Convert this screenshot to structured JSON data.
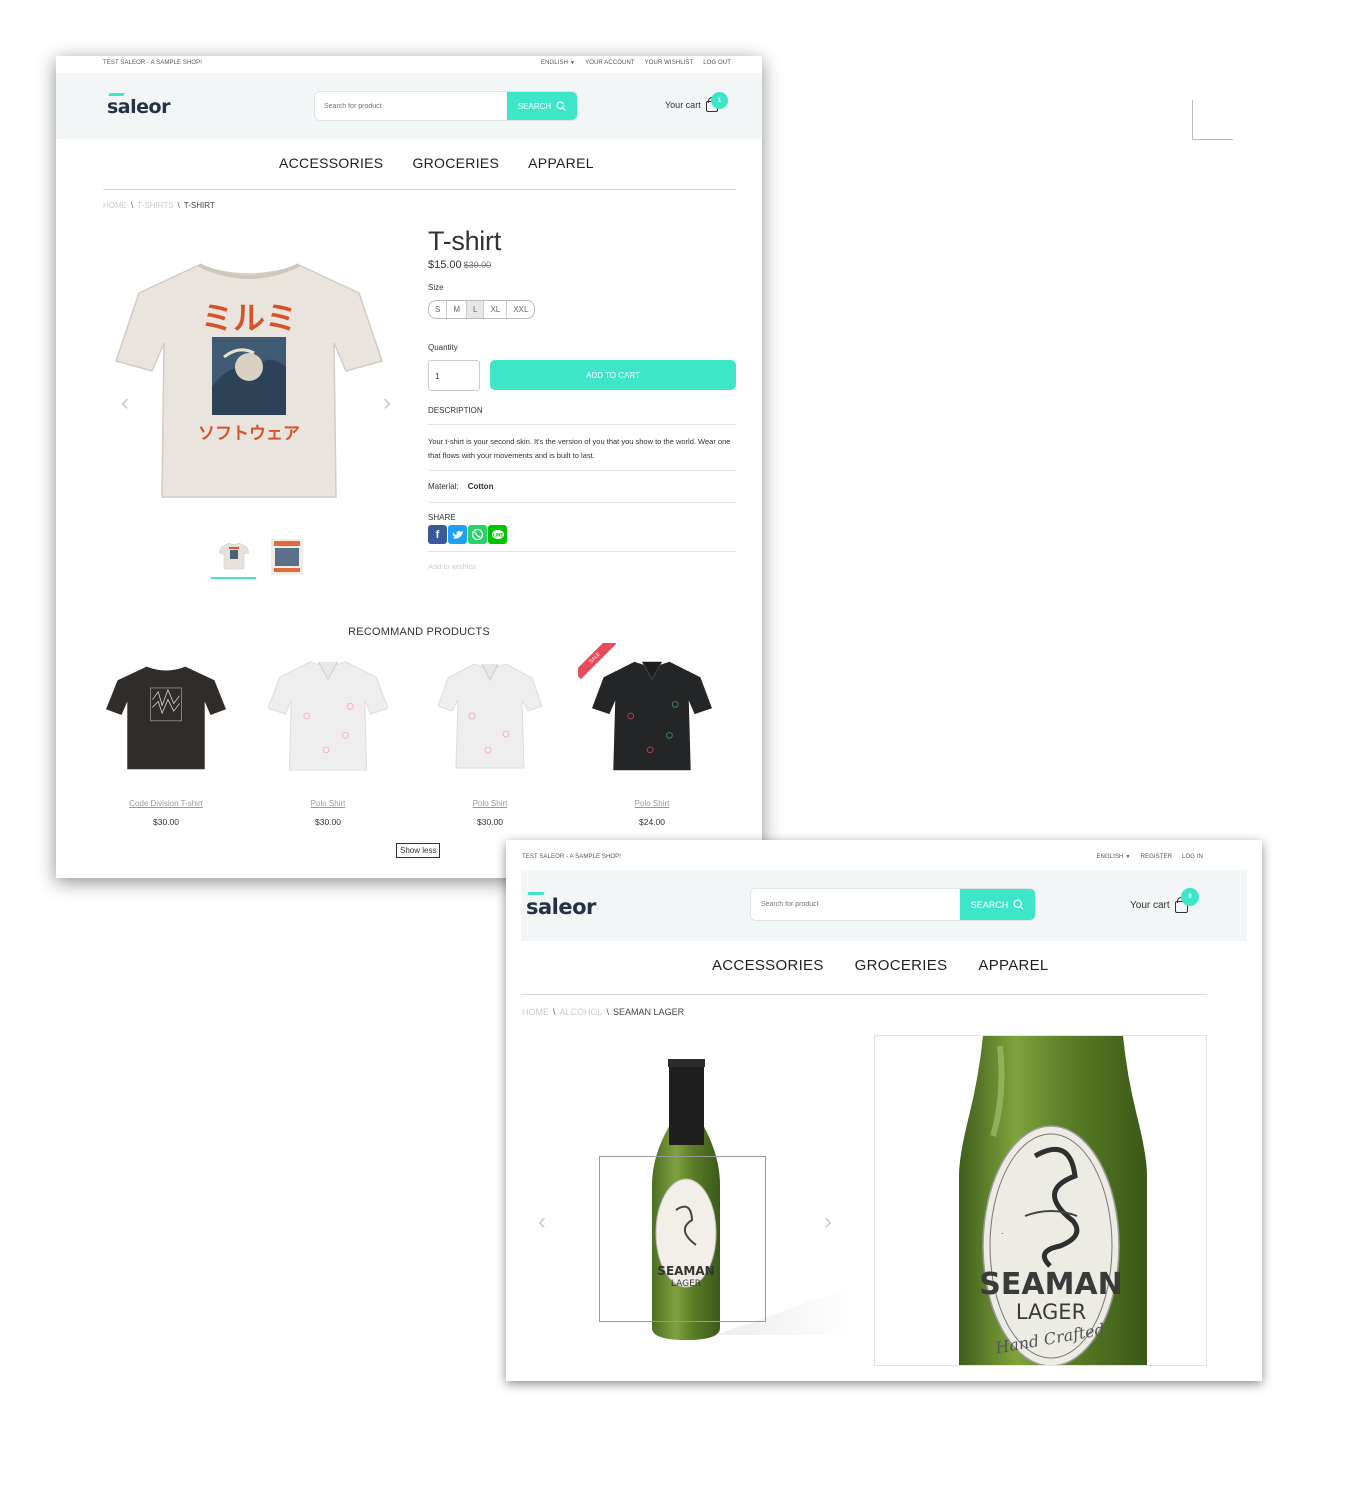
{
  "screens": {
    "product": {
      "topbar": {
        "tagline": "TEST SALEOR - A SAMPLE SHOP!",
        "links": [
          "ENGLISH",
          "YOUR ACCOUNT",
          "YOUR WISHLIST",
          "LOG OUT"
        ]
      },
      "logo": "saleor",
      "search": {
        "placeholder": "Search for product",
        "button": "SEARCH"
      },
      "cart": {
        "label": "Your cart",
        "count": "1"
      },
      "nav": [
        "ACCESSORIES",
        "GROCERIES",
        "APPAREL"
      ],
      "breadcrumb": {
        "home": "HOME",
        "category": "T-SHIRTS",
        "current": "T-SHIRT"
      },
      "product": {
        "title": "T-shirt",
        "price": "$15.00",
        "old_price": "$30.00",
        "size_label": "Size",
        "sizes": [
          "S",
          "M",
          "L",
          "XL",
          "XXL"
        ],
        "selected_size": "L",
        "quantity_label": "Quantity",
        "quantity": "1",
        "add_to_cart": "ADD TO CART",
        "description_heading": "DESCRIPTION",
        "description": "Your t-shirt is your second skin. It's the version of you that you show to the world. Wear one that flows with your movements and is built to last.",
        "material_label": "Material:",
        "material_value": "Cotton",
        "share_heading": "SHARE",
        "share_icons": [
          "facebook-icon",
          "twitter-icon",
          "whatsapp-icon",
          "line-icon"
        ],
        "wishlist": "Add to wishlist"
      },
      "recommended": {
        "title": "RECOMMAND PRODUCTS",
        "items": [
          {
            "name": "Code Division T-shirt",
            "price": "$30.00",
            "sale": false
          },
          {
            "name": "Polo Shirt",
            "price": "$30.00",
            "sale": false
          },
          {
            "name": "Polo Shirt",
            "price": "$30.00",
            "sale": false
          },
          {
            "name": "Polo Shirt",
            "price": "$24.00",
            "sale": true,
            "sale_label": "SALE"
          }
        ],
        "show_less": "Show less"
      }
    },
    "zoom": {
      "topbar": {
        "tagline": "TEST SALEOR - A SAMPLE SHOP!",
        "links": [
          "ENGLISH",
          "REGISTER",
          "LOG IN"
        ]
      },
      "logo": "saleor",
      "search": {
        "placeholder": "Search for product",
        "button": "SEARCH"
      },
      "cart": {
        "label": "Your cart",
        "count": "0"
      },
      "nav": [
        "ACCESSORIES",
        "GROCERIES",
        "APPAREL"
      ],
      "breadcrumb": {
        "home": "HOME",
        "category": "ALCOHOL",
        "current": "SEAMAN LAGER"
      },
      "bottle_label": {
        "line1": "SEAMAN",
        "line2": "LAGER",
        "line3": "Hand Crafted"
      }
    }
  },
  "colors": {
    "accent": "#3ee6c9",
    "header_bg": "#f2f6f6",
    "sale": "#e74c5b",
    "text": "#333333"
  }
}
